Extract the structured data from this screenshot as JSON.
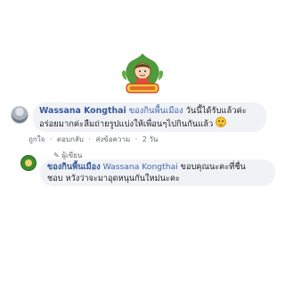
{
  "page": {
    "name": "ของกินพื้นเมือง"
  },
  "comment": {
    "author": "Wassana Kongthai",
    "tag": "ของกินพื้นเมือง",
    "text_line1_rest": "วันนี้ได้รับแล้วค่ะ",
    "text_line2": "อร่อยมากค่ะลืมถ่ายรูปแบ่งให้เพื่อนๆไปกินกันแล้ว",
    "emoji_icon": "grinning-face-icon",
    "actions": {
      "like": "ถูกใจ",
      "reply": "ตอบกลับ",
      "send": "ส่งข้อความ",
      "time": "2 วัน",
      "separator": "·"
    }
  },
  "reply": {
    "badge_icon": "pencil-icon",
    "badge": "ผู้เขียน",
    "author": "ของกินพื้นเมือง",
    "tag": "Wassana Kongthai",
    "text_line1_rest": "ขอบคุณนะคะที่ชื่น",
    "text_line2": "ชอบ หวังว่าจะมาอุดหนุนกันใหม่นะคะ"
  },
  "colors": {
    "link": "#385898",
    "bubble": "#f0f2f5",
    "meta": "#65676b"
  }
}
